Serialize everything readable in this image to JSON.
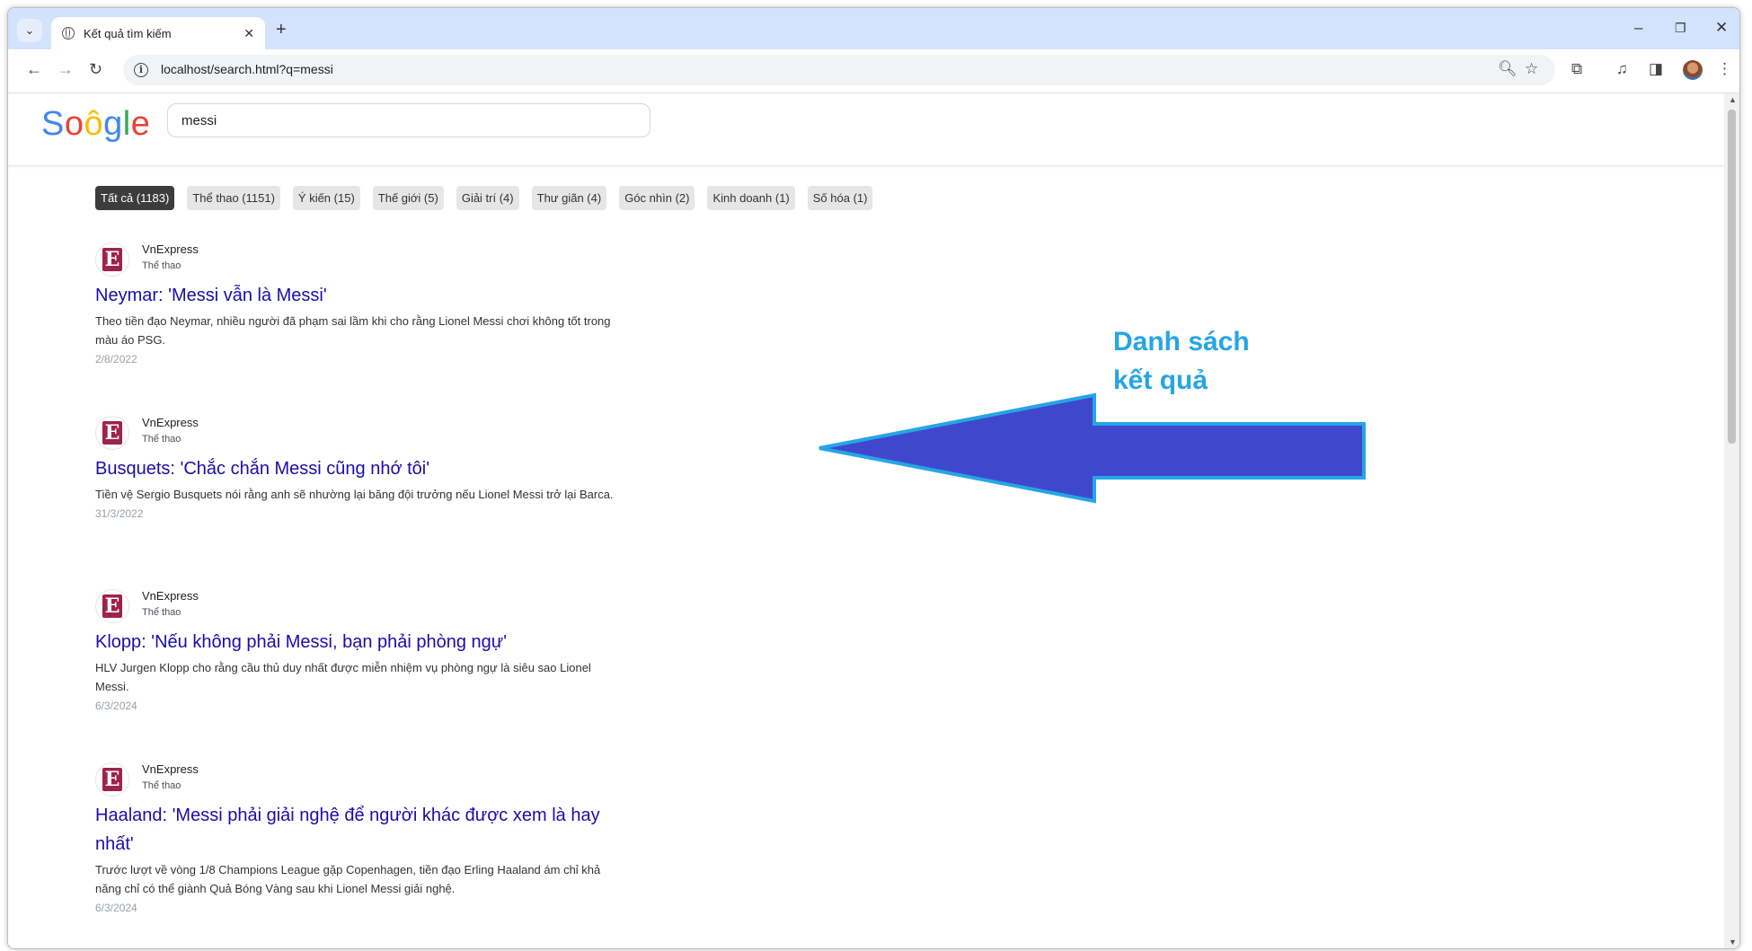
{
  "browser": {
    "tab_title": "Kết quả tìm kiếm",
    "url": "localhost/search.html?q=messi"
  },
  "search": {
    "logo": [
      "S",
      "o",
      "ô",
      "g",
      "l",
      "e"
    ],
    "logo_colors": [
      "#4285f4",
      "#ea4335",
      "#fbbc05",
      "#4285f4",
      "#34a853",
      "#ea4335"
    ],
    "query": "messi"
  },
  "filters": [
    {
      "label": "Tất cả (1183)",
      "active": true
    },
    {
      "label": "Thể thao (1151)",
      "active": false
    },
    {
      "label": "Ý kiến (15)",
      "active": false
    },
    {
      "label": "Thế giới (5)",
      "active": false
    },
    {
      "label": "Giải trí (4)",
      "active": false
    },
    {
      "label": "Thư giãn (4)",
      "active": false
    },
    {
      "label": "Góc nhìn (2)",
      "active": false
    },
    {
      "label": "Kinh doanh (1)",
      "active": false
    },
    {
      "label": "Số hóa (1)",
      "active": false
    }
  ],
  "results": [
    {
      "source": "VnExpress",
      "category": "Thể thao",
      "title": "Neymar: 'Messi vẫn là Messi'",
      "description": "Theo tiền đạo Neymar, nhiều người đã phạm sai lầm khi cho rằng Lionel Messi chơi không tốt trong màu áo PSG.",
      "date": "2/8/2022"
    },
    {
      "source": "VnExpress",
      "category": "Thể thao",
      "title": "Busquets: 'Chắc chắn Messi cũng nhớ tôi'",
      "description": "Tiền vệ Sergio Busquets nói rằng anh sẽ nhường lại băng đội trưởng nếu Lionel Messi trở lại Barca.",
      "date": "31/3/2022"
    },
    {
      "source": "VnExpress",
      "category": "Thể thao",
      "title": "Klopp: 'Nếu không phải Messi, bạn phải phòng ngự'",
      "description": "HLV Jurgen Klopp cho rằng cầu thủ duy nhất được miễn nhiệm vụ phòng ngự là siêu sao Lionel Messi.",
      "date": "6/3/2024"
    },
    {
      "source": "VnExpress",
      "category": "Thể thao",
      "title": "Haaland: 'Messi phải giải nghệ để người khác được xem là hay nhất'",
      "description": "Trước lượt về vòng 1/8 Champions League gặp Copenhagen, tiền đạo Erling Haaland ám chỉ khả năng chỉ có thể giành Quả Bóng Vàng sau khi Lionel Messi giải nghệ.",
      "date": "6/3/2024"
    }
  ],
  "annotation": {
    "line1": "Danh sách",
    "line2": "kết quả",
    "arrow_color": "#3f48cc",
    "outline_color": "#26a5e6"
  }
}
